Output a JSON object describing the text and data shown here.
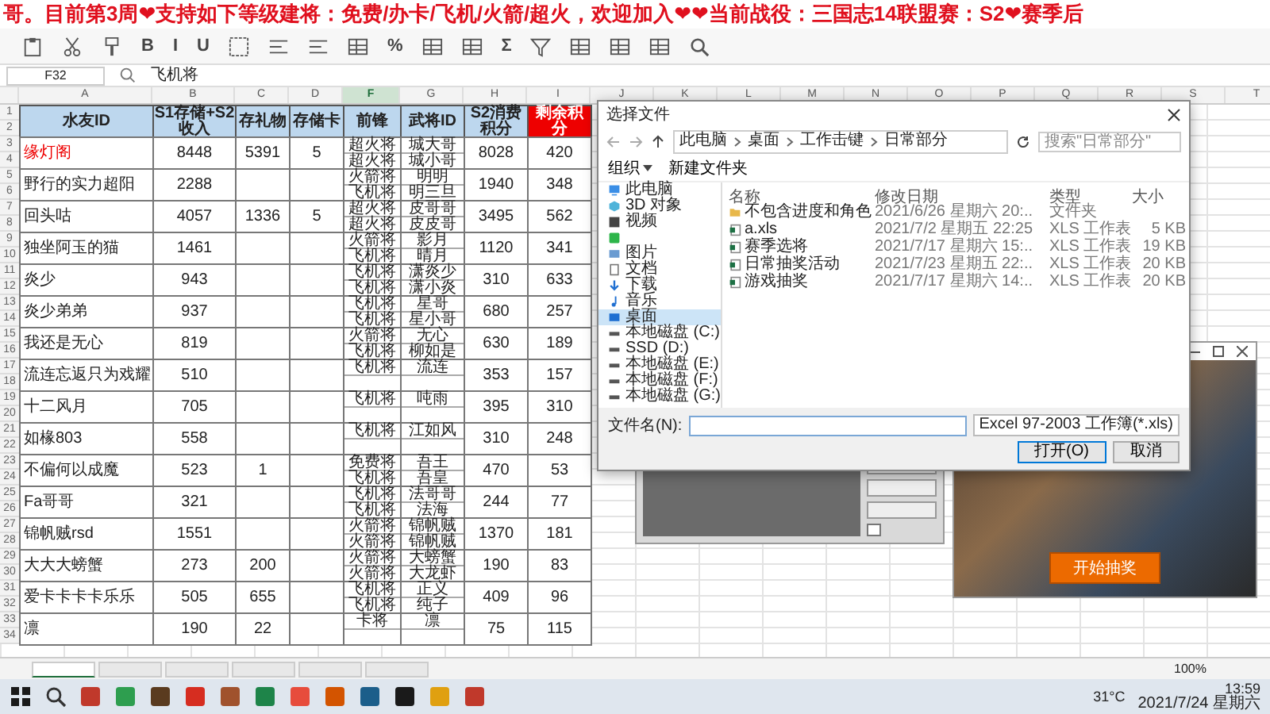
{
  "banner": {
    "text": "哥。目前第3周❤支持如下等级建将：免费/办卡/飞机/火箭/超火，欢迎加入❤❤当前战役：三国志14联盟赛：S2❤赛季后"
  },
  "ribbon": {
    "items": [
      {
        "kind": "paste"
      },
      {
        "kind": "scissors"
      },
      {
        "kind": "brush"
      },
      {
        "kind": "text",
        "label": "B"
      },
      {
        "kind": "text",
        "label": "I"
      },
      {
        "kind": "text",
        "label": "U"
      },
      {
        "kind": "border"
      },
      {
        "kind": "align"
      },
      {
        "kind": "align"
      },
      {
        "kind": "table"
      },
      {
        "kind": "text",
        "label": "%"
      },
      {
        "kind": "table"
      },
      {
        "kind": "table"
      },
      {
        "kind": "text",
        "label": "Σ"
      },
      {
        "kind": "filter"
      },
      {
        "kind": "table"
      },
      {
        "kind": "table"
      },
      {
        "kind": "table"
      },
      {
        "kind": "search"
      }
    ]
  },
  "formula_bar": {
    "cell": "F32",
    "value": "飞机将"
  },
  "sheet": {
    "letters": [
      {
        "letter": "A",
        "selected": false
      },
      {
        "letter": "B",
        "selected": false
      },
      {
        "letter": "C",
        "selected": false
      },
      {
        "letter": "D",
        "selected": false
      },
      {
        "letter": "F",
        "selected": true
      },
      {
        "letter": "G",
        "selected": false
      },
      {
        "letter": "H",
        "selected": false
      },
      {
        "letter": "I",
        "selected": false
      },
      {
        "letter": "J",
        "selected": false
      },
      {
        "letter": "K",
        "selected": false
      },
      {
        "letter": "L",
        "selected": false
      },
      {
        "letter": "M",
        "selected": false
      },
      {
        "letter": "N",
        "selected": false
      },
      {
        "letter": "O",
        "selected": false
      },
      {
        "letter": "P",
        "selected": false
      },
      {
        "letter": "Q",
        "selected": false
      },
      {
        "letter": "R",
        "selected": false
      },
      {
        "letter": "S",
        "selected": false
      },
      {
        "letter": "T",
        "selected": false
      }
    ],
    "header_rows": [
      "1",
      "2"
    ],
    "columns": [
      {
        "title": "水友ID",
        "highlight": false
      },
      {
        "title": "S1存储+S2收入",
        "highlight": false
      },
      {
        "title": "存礼物",
        "highlight": false
      },
      {
        "title": "存储卡",
        "highlight": false
      },
      {
        "title": "前锋",
        "highlight": false
      },
      {
        "title": "武将ID",
        "highlight": false
      },
      {
        "title": "S2消费积分",
        "highlight": false
      },
      {
        "title": "剩余积分",
        "highlight": true
      }
    ],
    "rows": [
      {
        "row_numbers": [
          "3",
          "4"
        ],
        "highlight": true,
        "cells": [
          "缘灯阁",
          "8448",
          "5391",
          "5",
          [
            "超火将",
            "超火将"
          ],
          [
            "城大哥",
            "城小哥"
          ],
          "8028",
          "420"
        ]
      },
      {
        "row_numbers": [
          "5",
          "6"
        ],
        "highlight": false,
        "cells": [
          "野行的实力超阳",
          "2288",
          null,
          null,
          [
            "火箭将",
            "飞机将"
          ],
          [
            "明明",
            "明三旦"
          ],
          "1940",
          "348"
        ]
      },
      {
        "row_numbers": [
          "7",
          "8"
        ],
        "highlight": false,
        "cells": [
          "回头咕",
          "4057",
          "1336",
          "5",
          [
            "超火将",
            "超火将"
          ],
          [
            "皮哥哥",
            "皮皮哥"
          ],
          "3495",
          "562"
        ]
      },
      {
        "row_numbers": [
          "9",
          "10"
        ],
        "highlight": false,
        "cells": [
          "独坐阿玉的猫",
          "1461",
          null,
          null,
          [
            "火箭将",
            "飞机将"
          ],
          [
            "影月",
            "晴月"
          ],
          "1120",
          "341"
        ]
      },
      {
        "row_numbers": [
          "11",
          "12"
        ],
        "highlight": false,
        "cells": [
          "炎少",
          "943",
          null,
          null,
          [
            "飞机将",
            "飞机将"
          ],
          [
            "潇炎少",
            "潇小炎"
          ],
          "310",
          "633"
        ]
      },
      {
        "row_numbers": [
          "13",
          "14"
        ],
        "highlight": false,
        "cells": [
          "炎少弟弟",
          "937",
          null,
          null,
          [
            "飞机将",
            "飞机将"
          ],
          [
            "星哥",
            "星小哥"
          ],
          "680",
          "257"
        ]
      },
      {
        "row_numbers": [
          "15",
          "16"
        ],
        "highlight": false,
        "cells": [
          "我还是无心",
          "819",
          null,
          null,
          [
            "火箭将",
            "飞机将"
          ],
          [
            "无心",
            "柳如是"
          ],
          "630",
          "189"
        ]
      },
      {
        "row_numbers": [
          "17",
          "18"
        ],
        "highlight": false,
        "cells": [
          "流连忘返只为戏耀",
          "510",
          null,
          null,
          [
            "飞机将"
          ],
          [
            "流连"
          ],
          "353",
          "157"
        ]
      },
      {
        "row_numbers": [
          "19",
          "20"
        ],
        "highlight": false,
        "cells": [
          "十二风月",
          "705",
          null,
          null,
          [
            "飞机将"
          ],
          [
            "吨雨"
          ],
          "395",
          "310"
        ]
      },
      {
        "row_numbers": [
          "21",
          "22"
        ],
        "highlight": false,
        "cells": [
          "如椽803",
          "558",
          null,
          null,
          [
            "飞机将"
          ],
          [
            "江如风"
          ],
          "310",
          "248"
        ]
      },
      {
        "row_numbers": [
          "23",
          "24"
        ],
        "highlight": false,
        "cells": [
          "不偏何以成魔",
          "523",
          "1",
          null,
          [
            "免费将",
            "飞机将"
          ],
          [
            "吾王",
            "吾皇"
          ],
          "470",
          "53"
        ]
      },
      {
        "row_numbers": [
          "25",
          "26"
        ],
        "highlight": false,
        "cells": [
          "Fa哥哥",
          "321",
          null,
          null,
          [
            "飞机将",
            "飞机将"
          ],
          [
            "法哥哥",
            "法海"
          ],
          "244",
          "77"
        ]
      },
      {
        "row_numbers": [
          "27",
          "28"
        ],
        "highlight": false,
        "cells": [
          "锦帆贼rsd",
          "1551",
          null,
          null,
          [
            "火箭将",
            "火箭将"
          ],
          [
            "锦帆贼",
            "锦帆贼"
          ],
          "1370",
          "181"
        ]
      },
      {
        "row_numbers": [
          "29",
          "30"
        ],
        "highlight": false,
        "cells": [
          "大大大螃蟹",
          "273",
          "200",
          null,
          [
            "火箭将",
            "火箭将"
          ],
          [
            "大螃蟹",
            "大龙虾"
          ],
          "190",
          "83"
        ]
      },
      {
        "row_numbers": [
          "31",
          "32"
        ],
        "highlight": false,
        "cells": [
          "爱卡卡卡卡乐乐",
          "505",
          "655",
          null,
          [
            "飞机将",
            "飞机将"
          ],
          [
            "正义",
            "纯子"
          ],
          "409",
          "96"
        ]
      },
      {
        "row_numbers": [
          "33",
          "34"
        ],
        "highlight": false,
        "cells": [
          "凛",
          "190",
          "22",
          null,
          [
            "卡将"
          ],
          [
            "凛"
          ],
          "75",
          "115"
        ]
      }
    ],
    "tabs": [
      {
        "selected": true
      },
      {
        "selected": false
      },
      {
        "selected": false
      },
      {
        "selected": false
      },
      {
        "selected": false
      },
      {
        "selected": false
      }
    ],
    "zoom": "100%"
  },
  "dialog": {
    "title": "选择文件",
    "path": [
      "此电脑",
      "桌面",
      "工作击键",
      "日常部分"
    ],
    "search_placeholder": "搜索\"日常部分\"",
    "organize": "组织",
    "new_folder": "新建文件夹",
    "nav": [
      {
        "kind": "pc",
        "label": "此电脑",
        "selected": false
      },
      {
        "kind": "cube",
        "label": "3D 对象",
        "selected": false
      },
      {
        "kind": "video",
        "label": "视频",
        "selected": false
      },
      {
        "kind": "app",
        "selected": false
      },
      {
        "kind": "picture",
        "label": "图片",
        "selected": false
      },
      {
        "kind": "doc",
        "label": "文档",
        "selected": false
      },
      {
        "kind": "download",
        "label": "下载",
        "selected": false
      },
      {
        "kind": "music",
        "label": "音乐",
        "selected": false
      },
      {
        "kind": "desktop",
        "label": "桌面",
        "selected": true
      },
      {
        "kind": "drive",
        "label": "本地磁盘 (C:)",
        "selected": false
      },
      {
        "kind": "drive",
        "label": "SSD (D:)",
        "selected": false
      },
      {
        "kind": "drive",
        "label": "本地磁盘 (E:)",
        "selected": false
      },
      {
        "kind": "drive",
        "label": "本地磁盘 (F:)",
        "selected": false
      },
      {
        "kind": "drive",
        "label": "本地磁盘 (G:)",
        "selected": false
      }
    ],
    "columns": [
      "名称",
      "修改日期",
      "类型",
      "大小"
    ],
    "files": [
      {
        "kind": "folder",
        "name": "不包含进度和角色",
        "date": "2021/6/26 星期六 20:..",
        "type": "文件夹"
      },
      {
        "kind": "sheet",
        "name": "a.xls",
        "date": "2021/7/2 星期五 22:25",
        "type": "XLS 工作表",
        "size": "5 KB"
      },
      {
        "kind": "sheet",
        "name": "赛季选将",
        "date": "2021/7/17 星期六 15:..",
        "type": "XLS 工作表",
        "size": "19 KB"
      },
      {
        "kind": "sheet",
        "name": "日常抽奖活动",
        "date": "2021/7/23 星期五 22:..",
        "type": "XLS 工作表",
        "size": "20 KB"
      },
      {
        "kind": "sheet",
        "name": "游戏抽奖",
        "date": "2021/7/17 星期六 14:..",
        "type": "XLS 工作表",
        "size": "20 KB"
      }
    ],
    "filename_label": "文件名(N):",
    "filter": "Excel 97-2003 工作簿(*.xls)",
    "open": "打开(O)",
    "cancel": "取消"
  },
  "grey_window": {
    "checkbox": {
      "checked": false
    }
  },
  "lottery": {
    "button": "开始抽奖"
  },
  "taskbar": {
    "items": [
      {
        "kind": "windows"
      },
      {
        "kind": "search"
      },
      {
        "kind": "app",
        "color": "#c0392b"
      },
      {
        "kind": "app",
        "color": "#2e9e4f"
      },
      {
        "kind": "app",
        "color": "#5a3b1f"
      },
      {
        "kind": "app",
        "color": "#d62d20"
      },
      {
        "kind": "app",
        "color": "#a0522d"
      },
      {
        "kind": "app",
        "color": "#1e8449"
      },
      {
        "kind": "app",
        "color": "#e74c3c"
      },
      {
        "kind": "app",
        "color": "#d35400"
      },
      {
        "kind": "app",
        "color": "#1b5e8a"
      },
      {
        "kind": "app",
        "color": "#1a1a1a"
      },
      {
        "kind": "app",
        "color": "#e0a010"
      },
      {
        "kind": "app",
        "color": "#c0392b"
      }
    ],
    "weather": "31°C",
    "time": "13:59",
    "date": "2021/7/24 星期六"
  }
}
